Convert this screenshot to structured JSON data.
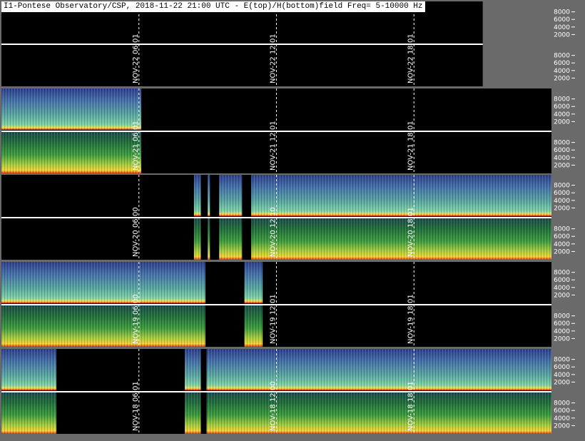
{
  "title": "I1-Pontese Observatory/CSP, 2018-11-22 21:00 UTC - E(top)/H(bottom)field Freq= 5-10000 Hz",
  "chart_data": {
    "type": "heatmap",
    "title": "I1-Pontese Observatory/CSP, 2018-11-22 21:00 UTC - E(top)/H(bottom)field Freq= 5-10000 Hz",
    "xlabel": "",
    "ylabel": "",
    "y_ticks": [
      2000,
      4000,
      6000,
      8000
    ],
    "y_tick_labels": [
      "2000",
      "4000",
      "6000",
      "8000"
    ],
    "ylim": [
      5,
      10000
    ],
    "x_range_hours": [
      0,
      24
    ],
    "colors": {
      "background": "#000000",
      "frame": "#6a6a6a",
      "separator": "#ffffff",
      "empty": "#060606"
    },
    "days": [
      {
        "day": "NOV-22",
        "markers": [
          {
            "hour": 6,
            "label": "NOV-22  06:01"
          },
          {
            "hour": 12,
            "label": "NOV-22  12:01"
          },
          {
            "hour": 18,
            "label": "NOV-22  18:01"
          }
        ],
        "data_end_hour": 21,
        "e_segments": [],
        "h_segments": []
      },
      {
        "day": "NOV-21",
        "markers": [
          {
            "hour": 6,
            "label": "NOV-21  06:01"
          },
          {
            "hour": 12,
            "label": "NOV-21  12:01"
          },
          {
            "hour": 18,
            "label": "NOV-21  18:01"
          }
        ],
        "data_end_hour": 24,
        "e_segments": [
          [
            0,
            6.1
          ]
        ],
        "h_segments": [
          [
            0,
            6.1
          ]
        ]
      },
      {
        "day": "NOV-20",
        "markers": [
          {
            "hour": 6,
            "label": "NOV-20  06:00"
          },
          {
            "hour": 12,
            "label": "NOV-20  12:10"
          },
          {
            "hour": 18,
            "label": "NOV-20  18:01"
          }
        ],
        "data_end_hour": 24,
        "e_segments": [
          [
            8.4,
            8.7
          ],
          [
            9.0,
            9.1
          ],
          [
            9.5,
            10.5
          ],
          [
            10.9,
            24
          ]
        ],
        "h_segments": [
          [
            8.4,
            8.7
          ],
          [
            9.0,
            9.1
          ],
          [
            9.5,
            10.5
          ],
          [
            10.9,
            24
          ]
        ]
      },
      {
        "day": "NOV-19",
        "markers": [
          {
            "hour": 6,
            "label": "NOV-19  06:00"
          },
          {
            "hour": 12,
            "label": "NOV-19  12:01"
          },
          {
            "hour": 18,
            "label": "NOV-19  18:01"
          }
        ],
        "data_end_hour": 24,
        "e_segments": [
          [
            0,
            8.9
          ],
          [
            10.6,
            11.4
          ]
        ],
        "h_segments": [
          [
            0,
            8.9
          ],
          [
            10.6,
            11.4
          ]
        ]
      },
      {
        "day": "NOV-18",
        "markers": [
          {
            "hour": 6,
            "label": "NOV-18  06:01"
          },
          {
            "hour": 12,
            "label": "NOV-18  12:00"
          },
          {
            "hour": 18,
            "label": "NOV-18  18:01"
          }
        ],
        "data_end_hour": 24,
        "e_segments": [
          [
            0,
            2.4
          ],
          [
            8.0,
            8.7
          ],
          [
            8.95,
            24
          ]
        ],
        "h_segments": [
          [
            0,
            2.4
          ],
          [
            8.0,
            8.7
          ],
          [
            8.95,
            24
          ]
        ]
      }
    ]
  }
}
